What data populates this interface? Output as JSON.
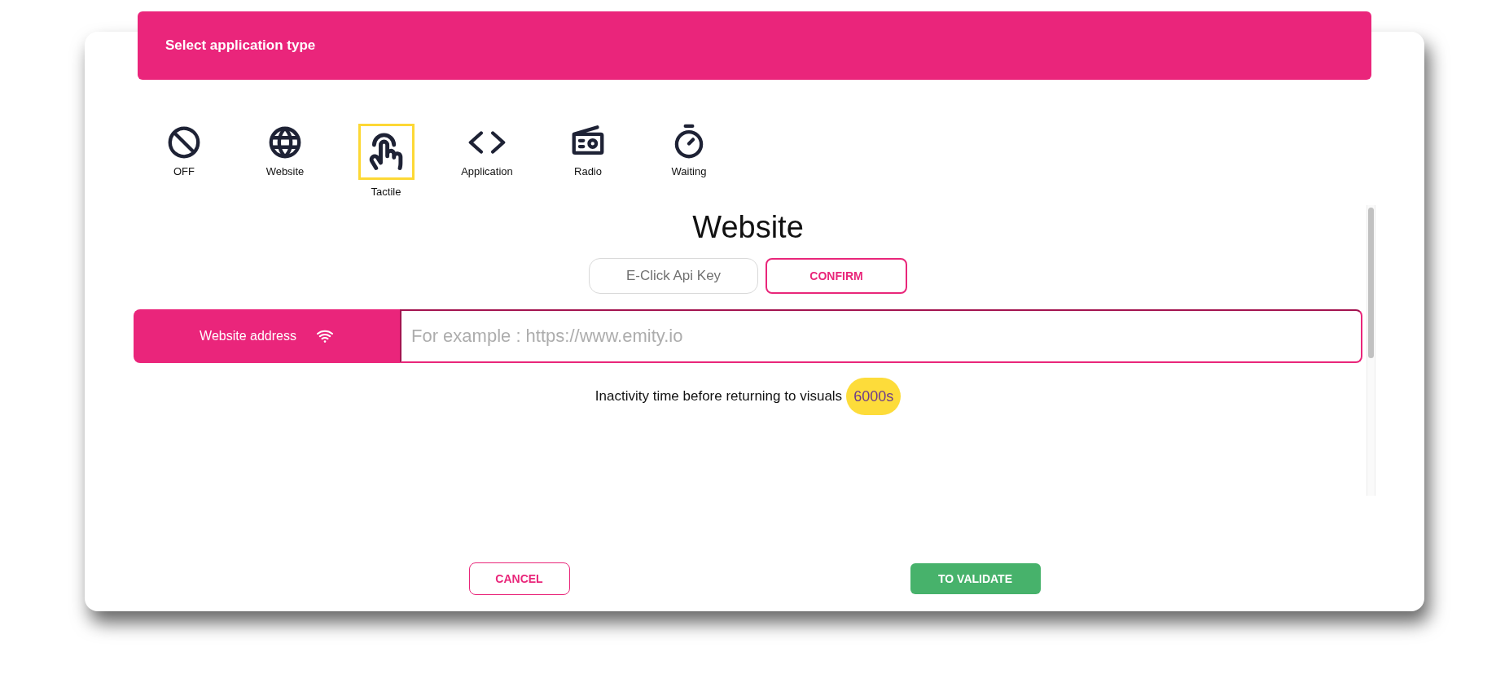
{
  "header": {
    "title": "Select application type"
  },
  "app_types": [
    {
      "label": "OFF",
      "selected": false
    },
    {
      "label": "Website",
      "selected": false
    },
    {
      "label": "Tactile",
      "selected": true
    },
    {
      "label": "Application",
      "selected": false
    },
    {
      "label": "Radio",
      "selected": false
    },
    {
      "label": "Waiting",
      "selected": false
    }
  ],
  "panel": {
    "title": "Website",
    "buttons": [
      {
        "label": "E-Click Api Key",
        "kind": "secondary"
      },
      {
        "label": "CONFIRM",
        "kind": "primary"
      }
    ],
    "address_field": {
      "label": "Website address",
      "placeholder": "For example : https://www.emity.io"
    },
    "inactivity": {
      "text": "Inactivity time before returning to visuals",
      "value": "6000s"
    }
  },
  "actions": [
    {
      "label": "CANCEL",
      "kind": "outline"
    },
    {
      "label": "TO VALIDATE",
      "kind": "filled"
    }
  ]
}
